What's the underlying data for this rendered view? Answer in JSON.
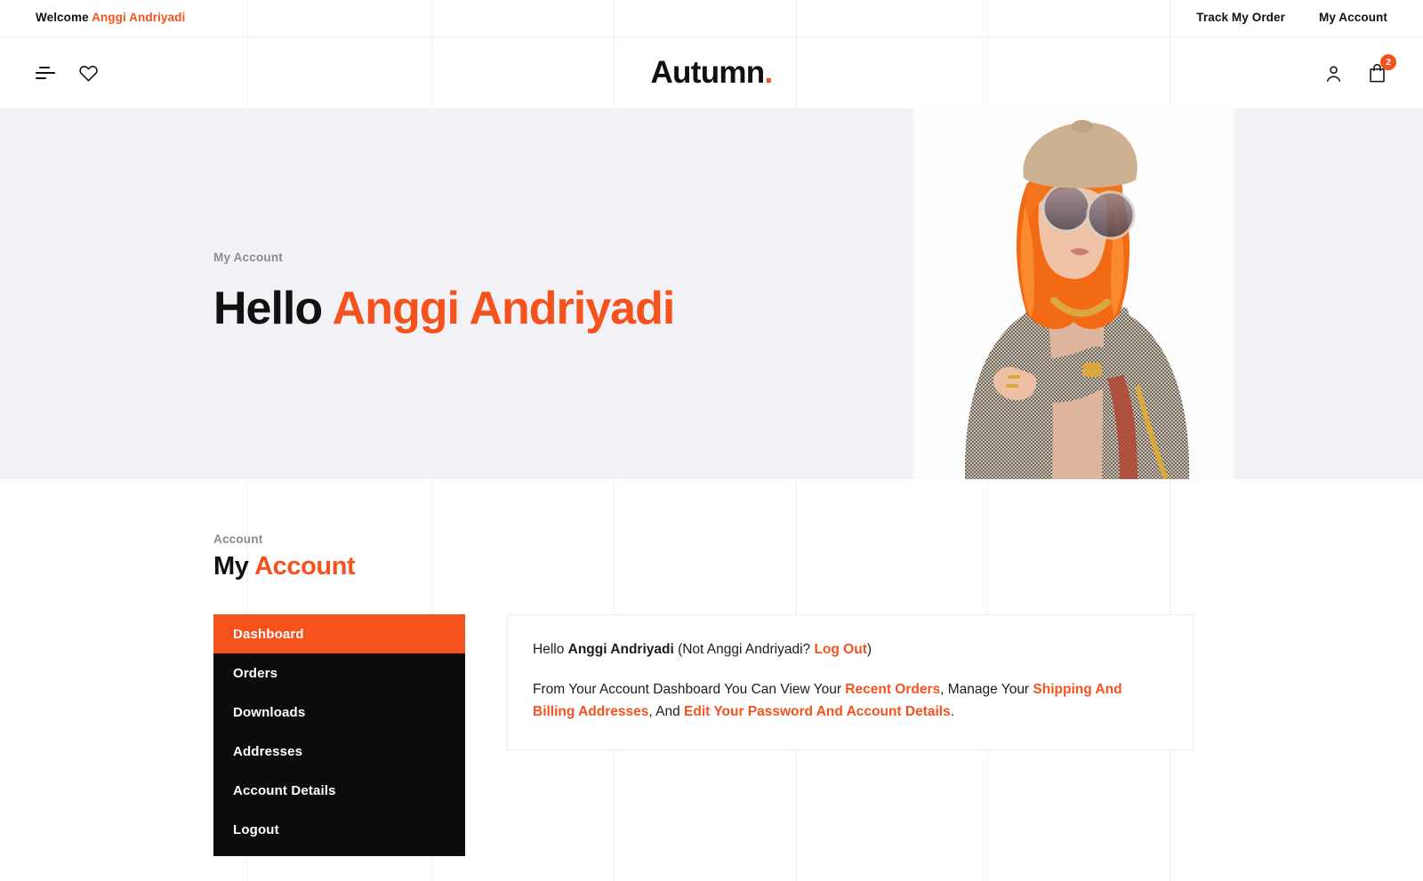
{
  "colors": {
    "accent": "#f5521e",
    "dark": "#0c0c0c",
    "hero_bg": "#f2f2f6",
    "muted": "#8a8a93"
  },
  "topbar": {
    "welcome_prefix": "Welcome",
    "welcome_user": "Anggi Andriyadi",
    "links": [
      {
        "label": "Track My Order"
      },
      {
        "label": "My Account"
      }
    ]
  },
  "header": {
    "logo_text": "Autumn",
    "logo_dot": ".",
    "menu_icon": "hamburger-menu-icon",
    "wishlist_icon": "heart-icon",
    "account_icon": "user-icon",
    "cart_icon": "shopping-bag-icon",
    "cart_count": "2"
  },
  "hero": {
    "breadcrumb": "My Account",
    "greeting": "Hello",
    "user_name": "Anggi Andriyadi",
    "image_alt": "woman-in-beret-and-houndstooth-blazer"
  },
  "account_section": {
    "breadcrumb": "Account",
    "title_plain": "My",
    "title_accent": "Account",
    "nav": [
      {
        "label": "Dashboard",
        "active": true
      },
      {
        "label": "Orders",
        "active": false
      },
      {
        "label": "Downloads",
        "active": false
      },
      {
        "label": "Addresses",
        "active": false
      },
      {
        "label": "Account Details",
        "active": false
      },
      {
        "label": "Logout",
        "active": false
      }
    ],
    "panel": {
      "line1_a": "Hello ",
      "line1_name": "Anggi Andriyadi",
      "line1_b": " (Not Anggi Andriyadi? ",
      "line1_logout": "Log Out",
      "line1_c": ")",
      "line2_a": "From Your Account Dashboard You Can View Your ",
      "line2_link1": "Recent Orders",
      "line2_b": ", Manage Your ",
      "line2_link2": "Shipping And Billing Addresses",
      "line2_c": ", And ",
      "line2_link3": "Edit Your Password And Account Details",
      "line2_d": "."
    }
  }
}
